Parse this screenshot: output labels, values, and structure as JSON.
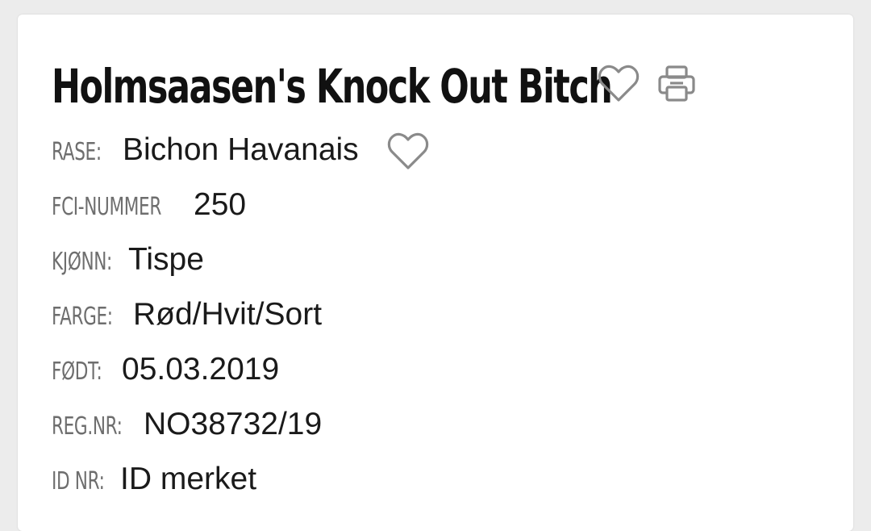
{
  "dog": {
    "name": "Holmsaasen's Knock Out Bitch"
  },
  "icons": {
    "favorite": "heart-outline-icon",
    "print": "printer-icon",
    "breed_favorite": "heart-outline-icon"
  },
  "colors": {
    "label": "#6e6e6e",
    "value": "#1a1a1a",
    "icon": "#8a8a8a",
    "title": "#111111"
  },
  "fields": {
    "breed": {
      "label": "RASE:",
      "value": "Bichon Havanais"
    },
    "fci": {
      "label": "FCI-NUMMER",
      "value": "250"
    },
    "sex": {
      "label": "KJØNN:",
      "value": "Tispe"
    },
    "color": {
      "label": "FARGE:",
      "value": "Rød/Hvit/Sort"
    },
    "born": {
      "label": "FØDT:",
      "value": "05.03.2019"
    },
    "regnr": {
      "label": "REG.NR:",
      "value": "NO38732/19"
    },
    "idnr": {
      "label": "ID NR:",
      "value": "ID merket"
    }
  }
}
